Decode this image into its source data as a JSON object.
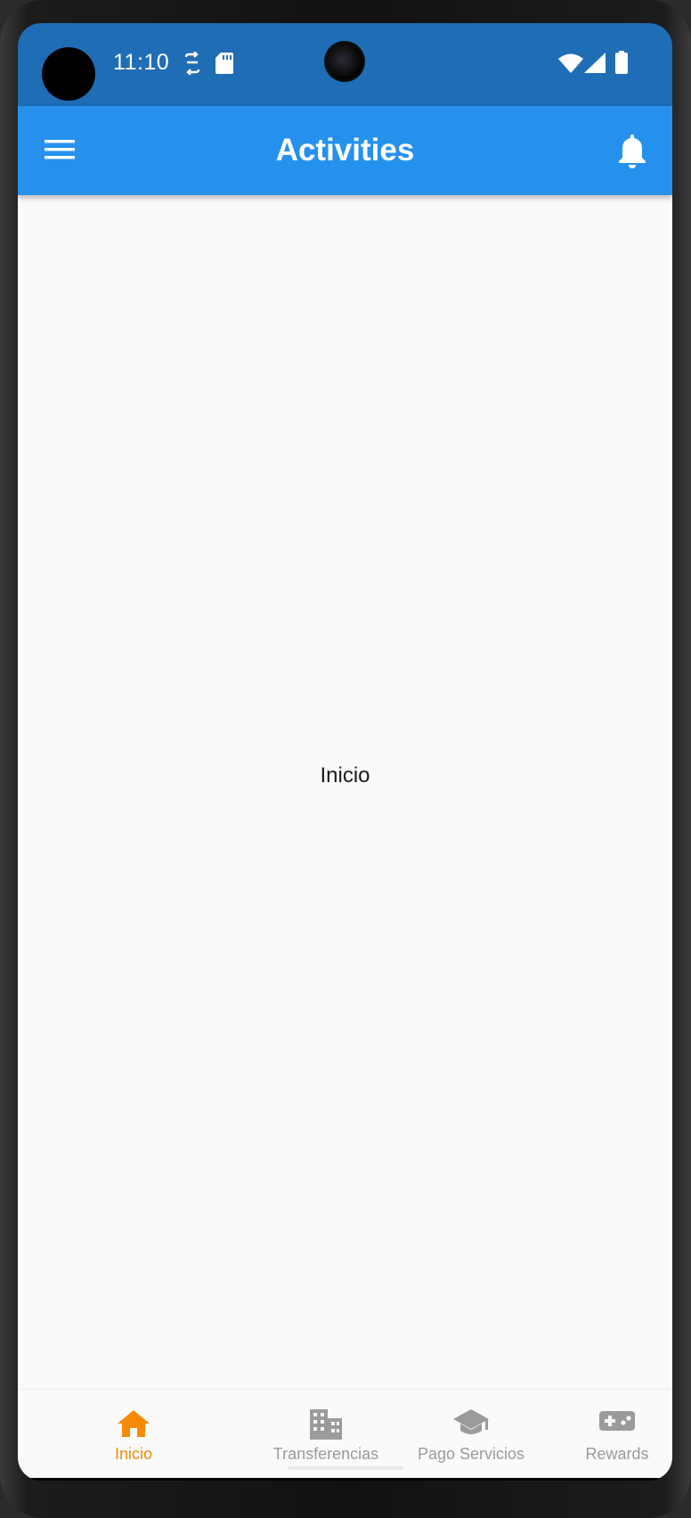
{
  "status_bar": {
    "time": "11:10",
    "icons": [
      "sync-icon",
      "sd-card-icon",
      "wifi-icon",
      "cell-signal-icon",
      "battery-icon"
    ]
  },
  "app_bar": {
    "title": "Activities",
    "left_icon": "menu-icon",
    "right_icon": "notifications-bell-icon",
    "color": "#2691ed"
  },
  "content": {
    "text": "Inicio"
  },
  "bottom_nav": {
    "active_color": "#f58a07",
    "inactive_color": "#9b9b9b",
    "items": [
      {
        "label": "Inicio",
        "icon": "home-icon",
        "active": true
      },
      {
        "label": "Transferencias",
        "icon": "building-icon",
        "active": false
      },
      {
        "label": "Pago Servicios",
        "icon": "school-icon",
        "active": false
      },
      {
        "label": "Rewards",
        "icon": "gamepad-icon",
        "active": false
      }
    ]
  }
}
